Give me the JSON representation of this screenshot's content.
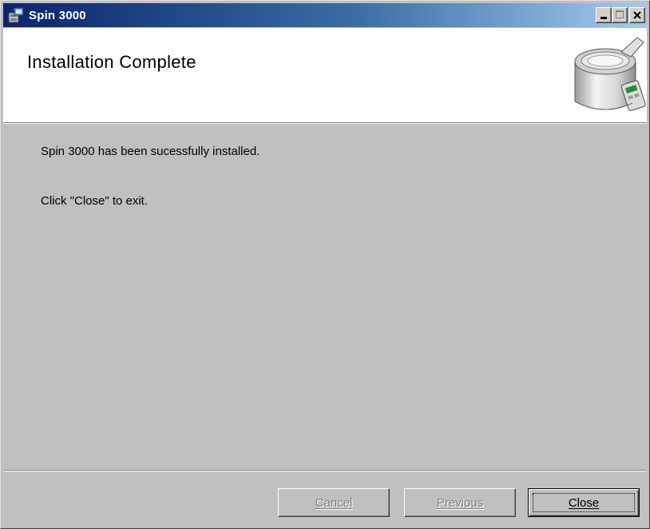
{
  "window": {
    "title": "Spin 3000",
    "caption_buttons": [
      "minimize",
      "maximize",
      "close"
    ]
  },
  "banner": {
    "title": "Installation Complete",
    "image": "bread-machine-illustration"
  },
  "content": {
    "message": "Spin 3000 has been sucessfully installed.",
    "instruction": "Click \"Close\" to exit."
  },
  "buttons": {
    "cancel": {
      "label": "Cancel",
      "enabled": false
    },
    "previous": {
      "label": "Previous",
      "enabled": false
    },
    "close": {
      "label": "Close",
      "enabled": true,
      "default": true
    }
  },
  "icons": {
    "app": "installer-icon",
    "minimize": "minimize-icon",
    "maximize": "maximize-icon",
    "close": "close-icon"
  },
  "colors": {
    "titlebar_start": "#0a246a",
    "titlebar_end": "#a6caf0",
    "face": "#c0c0c0",
    "banner_bg": "#ffffff",
    "disabled_text": "#808080"
  }
}
